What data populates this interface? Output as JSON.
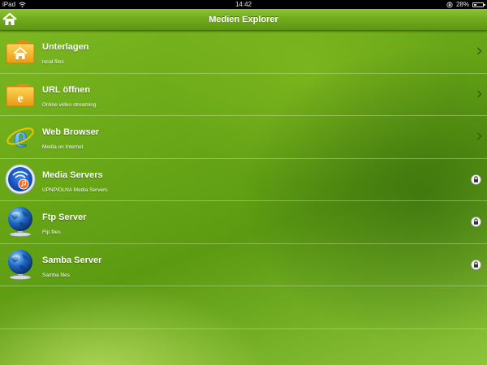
{
  "status_bar": {
    "device": "iPad",
    "time": "14:42",
    "battery": "28%",
    "battery_level": 0.28
  },
  "nav": {
    "title": "Medien Explorer",
    "home_icon": "home-icon"
  },
  "items": [
    {
      "title": "Unterlagen",
      "subtitle": "local files",
      "icon": "home-folder-icon",
      "accessory": "chevron"
    },
    {
      "title": "URL öffnen",
      "subtitle": "Online video streaming",
      "icon": "url-folder-icon",
      "accessory": "chevron"
    },
    {
      "title": "Web Browser",
      "subtitle": "Media on Internet",
      "icon": "browser-icon",
      "accessory": "chevron"
    },
    {
      "title": "Media Servers",
      "subtitle": "UPNP/DLNA Media Servers",
      "icon": "media-server-icon",
      "accessory": "lock"
    },
    {
      "title": "Ftp Server",
      "subtitle": "Ftp files",
      "icon": "globe-server-icon",
      "accessory": "lock"
    },
    {
      "title": "Samba Server",
      "subtitle": "Samba files",
      "icon": "globe-server-icon",
      "accessory": "lock"
    }
  ],
  "colors": {
    "background": "#6aa818",
    "navbar": "#6fa91c",
    "text": "#ffffff",
    "folder": "#f0b429",
    "globe": "#1d5fb8"
  }
}
